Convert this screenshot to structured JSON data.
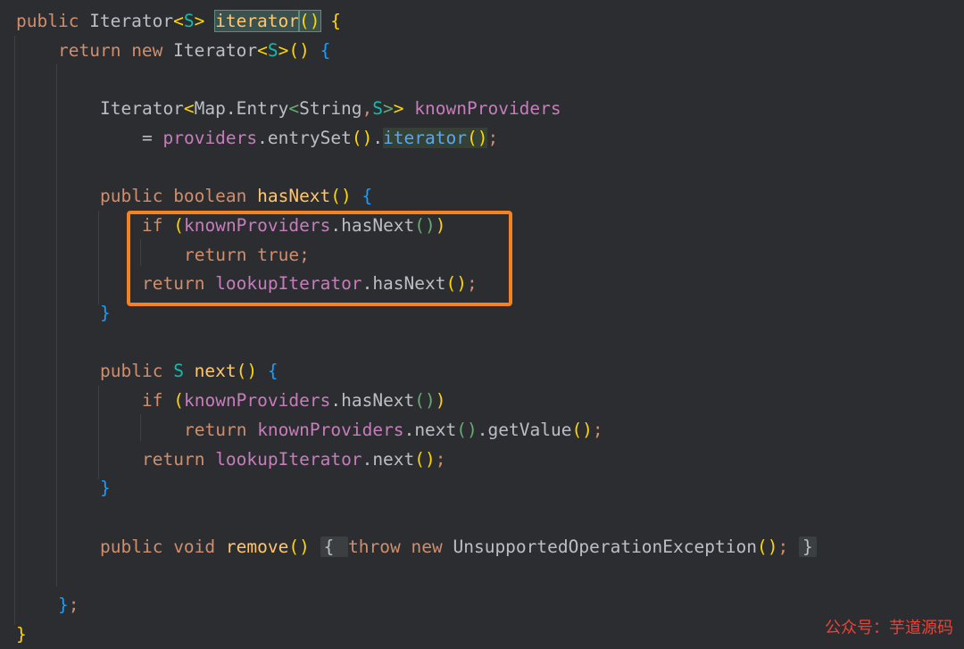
{
  "editor": {
    "lines": [
      {
        "indent": 0,
        "tokens": [
          {
            "t": "public ",
            "c": "kw"
          },
          {
            "t": "Iterator",
            "c": "id"
          },
          {
            "t": "<",
            "c": "br1"
          },
          {
            "t": "S",
            "c": "gen2"
          },
          {
            "t": "> ",
            "c": "br1"
          },
          {
            "t": "iterator",
            "c": "dec",
            "hl": "box"
          },
          {
            "t": "()",
            "c": "br1",
            "hl": "box"
          },
          {
            "t": " ",
            "c": "pun"
          },
          {
            "t": "{",
            "c": "br1"
          }
        ]
      },
      {
        "indent": 1,
        "tokens": [
          {
            "t": "return ",
            "c": "kw"
          },
          {
            "t": "new ",
            "c": "kw"
          },
          {
            "t": "Iterator",
            "c": "id"
          },
          {
            "t": "<",
            "c": "br1"
          },
          {
            "t": "S",
            "c": "gen2"
          },
          {
            "t": ">",
            "c": "br1"
          },
          {
            "t": "()",
            "c": "br1"
          },
          {
            "t": " ",
            "c": "pun"
          },
          {
            "t": "{",
            "c": "br3"
          }
        ]
      },
      {
        "indent": 2,
        "tokens": []
      },
      {
        "indent": 2,
        "tokens": [
          {
            "t": "Iterator",
            "c": "id"
          },
          {
            "t": "<",
            "c": "br1"
          },
          {
            "t": "Map.Entry",
            "c": "id"
          },
          {
            "t": "<",
            "c": "gen"
          },
          {
            "t": "String",
            "c": "id"
          },
          {
            "t": ",",
            "c": "kw"
          },
          {
            "t": "S",
            "c": "gen2"
          },
          {
            "t": ">",
            "c": "gen"
          },
          {
            "t": ">",
            "c": "br1"
          },
          {
            "t": " knownProviders",
            "c": "fld"
          }
        ]
      },
      {
        "indent": 3,
        "tokens": [
          {
            "t": "= ",
            "c": "pun"
          },
          {
            "t": "providers",
            "c": "fld"
          },
          {
            "t": ".",
            "c": "pun"
          },
          {
            "t": "entrySet",
            "c": "id"
          },
          {
            "t": "()",
            "c": "br1"
          },
          {
            "t": ".",
            "c": "pun"
          },
          {
            "t": "iterator",
            "c": "mth",
            "hl": "green"
          },
          {
            "t": "()",
            "c": "br1",
            "hl": "green"
          },
          {
            "t": ";",
            "c": "kw"
          }
        ]
      },
      {
        "indent": 2,
        "tokens": []
      },
      {
        "indent": 2,
        "tokens": [
          {
            "t": "public ",
            "c": "kw"
          },
          {
            "t": "boolean ",
            "c": "kw"
          },
          {
            "t": "hasNext",
            "c": "dec"
          },
          {
            "t": "() ",
            "c": "br1"
          },
          {
            "t": "{",
            "c": "br3"
          }
        ]
      },
      {
        "indent": 3,
        "tokens": [
          {
            "t": "if ",
            "c": "kw"
          },
          {
            "t": "(",
            "c": "br1"
          },
          {
            "t": "knownProviders",
            "c": "fld"
          },
          {
            "t": ".",
            "c": "pun"
          },
          {
            "t": "hasNext",
            "c": "id"
          },
          {
            "t": "()",
            "c": "gen"
          },
          {
            "t": ")",
            "c": "br1"
          }
        ]
      },
      {
        "indent": 4,
        "tokens": [
          {
            "t": "return ",
            "c": "kw"
          },
          {
            "t": "true",
            "c": "kw"
          },
          {
            "t": ";",
            "c": "kw"
          }
        ]
      },
      {
        "indent": 3,
        "tokens": [
          {
            "t": "return ",
            "c": "kw"
          },
          {
            "t": "lookupIterator",
            "c": "fld"
          },
          {
            "t": ".",
            "c": "pun"
          },
          {
            "t": "hasNext",
            "c": "id"
          },
          {
            "t": "()",
            "c": "br1"
          },
          {
            "t": ";",
            "c": "kw"
          }
        ]
      },
      {
        "indent": 2,
        "tokens": [
          {
            "t": "}",
            "c": "br3"
          }
        ]
      },
      {
        "indent": 2,
        "tokens": []
      },
      {
        "indent": 2,
        "tokens": [
          {
            "t": "public ",
            "c": "kw"
          },
          {
            "t": "S ",
            "c": "gen2"
          },
          {
            "t": "next",
            "c": "dec"
          },
          {
            "t": "() ",
            "c": "br1"
          },
          {
            "t": "{",
            "c": "br3"
          }
        ]
      },
      {
        "indent": 3,
        "tokens": [
          {
            "t": "if ",
            "c": "kw"
          },
          {
            "t": "(",
            "c": "br1"
          },
          {
            "t": "knownProviders",
            "c": "fld"
          },
          {
            "t": ".",
            "c": "pun"
          },
          {
            "t": "hasNext",
            "c": "id"
          },
          {
            "t": "()",
            "c": "gen"
          },
          {
            "t": ")",
            "c": "br1"
          }
        ]
      },
      {
        "indent": 4,
        "tokens": [
          {
            "t": "return ",
            "c": "kw"
          },
          {
            "t": "knownProviders",
            "c": "fld"
          },
          {
            "t": ".",
            "c": "pun"
          },
          {
            "t": "next",
            "c": "id"
          },
          {
            "t": "()",
            "c": "gen"
          },
          {
            "t": ".",
            "c": "pun"
          },
          {
            "t": "getValue",
            "c": "id"
          },
          {
            "t": "()",
            "c": "br1"
          },
          {
            "t": ";",
            "c": "kw"
          }
        ]
      },
      {
        "indent": 3,
        "tokens": [
          {
            "t": "return ",
            "c": "kw"
          },
          {
            "t": "lookupIterator",
            "c": "fld"
          },
          {
            "t": ".",
            "c": "pun"
          },
          {
            "t": "next",
            "c": "id"
          },
          {
            "t": "()",
            "c": "br1"
          },
          {
            "t": ";",
            "c": "kw"
          }
        ]
      },
      {
        "indent": 2,
        "tokens": [
          {
            "t": "}",
            "c": "br3"
          }
        ]
      },
      {
        "indent": 2,
        "tokens": []
      },
      {
        "indent": 2,
        "tokens": [
          {
            "t": "public ",
            "c": "kw"
          },
          {
            "t": "void ",
            "c": "kw"
          },
          {
            "t": "remove",
            "c": "dec"
          },
          {
            "t": "()",
            "c": "br1"
          },
          {
            "t": " ",
            "c": "pun"
          },
          {
            "t": "{ ",
            "c": "pun",
            "hl": "fold"
          },
          {
            "t": "throw ",
            "c": "kw"
          },
          {
            "t": "new ",
            "c": "kw"
          },
          {
            "t": "UnsupportedOperationException",
            "c": "id"
          },
          {
            "t": "()",
            "c": "br1"
          },
          {
            "t": ";",
            "c": "kw"
          },
          {
            "t": " ",
            "c": "pun"
          },
          {
            "t": "}",
            "c": "pun",
            "hl": "fold"
          }
        ]
      },
      {
        "indent": 2,
        "tokens": []
      },
      {
        "indent": 1,
        "tokens": [
          {
            "t": "}",
            "c": "br3"
          },
          {
            "t": ";",
            "c": "kw"
          }
        ]
      },
      {
        "indent": 0,
        "tokens": [
          {
            "t": "}",
            "c": "br1"
          }
        ]
      }
    ]
  },
  "watermark": "公众号：芋道源码",
  "colors": {
    "background": "#2b2d30",
    "keyword": "#cf8e6d",
    "field": "#c77dbb",
    "highlight_box_border": "#f48220"
  }
}
